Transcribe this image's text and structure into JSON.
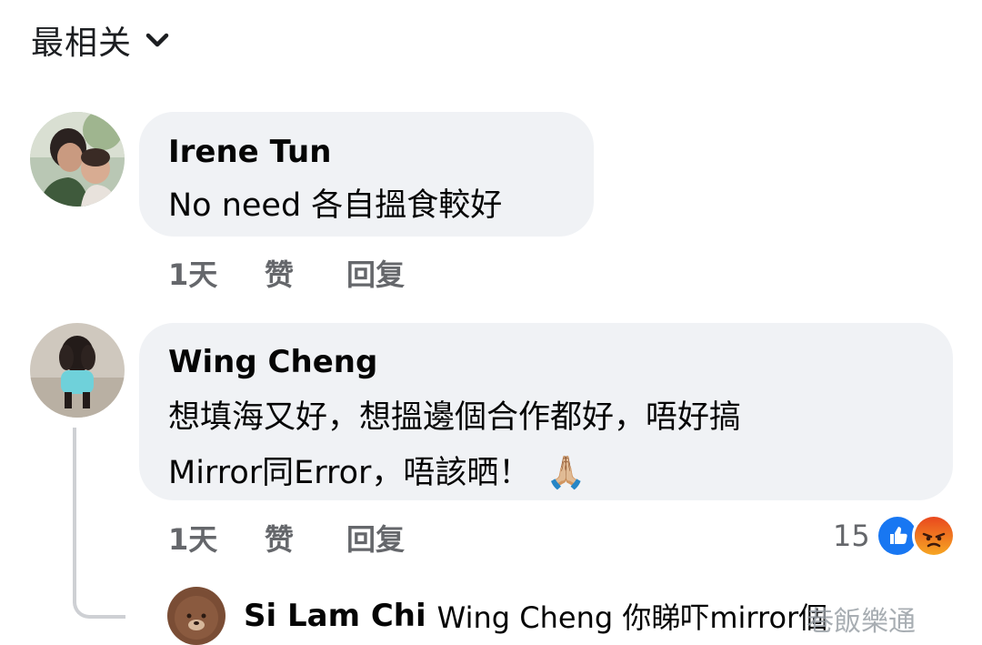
{
  "sort": {
    "label": "最相关",
    "icon": "chevron-down-icon"
  },
  "comments": [
    {
      "author": "Irene Tun",
      "text": "No need 各自搵食較好",
      "time": "1天",
      "like_label": "赞",
      "reply_label": "回复"
    },
    {
      "author": "Wing Cheng",
      "text_line1": "想填海又好，想搵邊個合作都好，唔好搞",
      "text_line2": "Mirror同Error，唔該晒！",
      "emoji": "🙏🏼",
      "time": "1天",
      "like_label": "赞",
      "reply_label": "回复",
      "reaction_count": "15",
      "reaction_icons": [
        "like-icon",
        "angry-icon"
      ]
    }
  ],
  "reply": {
    "author": "Si Lam Chi",
    "text": "Wing Cheng 你睇吓mirror個"
  },
  "watermark": "巷飯樂通",
  "colors": {
    "bubble": "#f0f2f5",
    "meta": "#65676b",
    "like_blue": "#1877f2",
    "angry": "#f0541e"
  }
}
